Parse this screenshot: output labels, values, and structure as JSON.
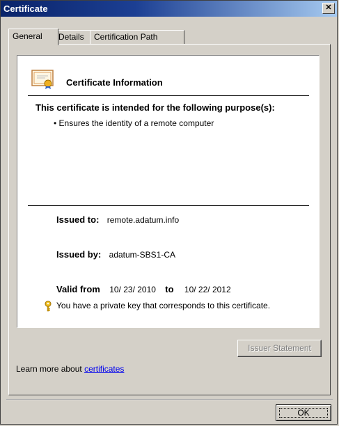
{
  "window": {
    "title": "Certificate",
    "close_glyph": "✕"
  },
  "tabs": [
    {
      "label": "General",
      "active": true
    },
    {
      "label": "Details",
      "active": false
    },
    {
      "label": "Certification Path",
      "active": false
    }
  ],
  "certificate": {
    "heading": "Certificate Information",
    "purpose_heading": "This certificate is intended for the following purpose(s):",
    "purposes": [
      "• Ensures the identity of a remote computer"
    ],
    "issued_to_label": "Issued to:",
    "issued_to": "remote.adatum.info",
    "issued_by_label": "Issued by:",
    "issued_by": "adatum-SBS1-CA",
    "valid_from_label": "Valid from",
    "valid_from": "10/ 23/ 2010",
    "to_label": "to",
    "valid_to": "10/ 22/ 2012",
    "private_key_note": "You have a private key that corresponds to this certificate."
  },
  "buttons": {
    "issuer_statement": "Issuer Statement",
    "ok": "OK"
  },
  "learn_more": {
    "prefix": "Learn more about ",
    "link": "certificates"
  },
  "icons": {
    "certificate": "certificate-icon",
    "key": "key-icon",
    "close": "close-icon"
  },
  "colors": {
    "titlebar_start": "#0a246a",
    "titlebar_end": "#a6caf0",
    "link": "#0000ee",
    "key": "#e0b020"
  }
}
